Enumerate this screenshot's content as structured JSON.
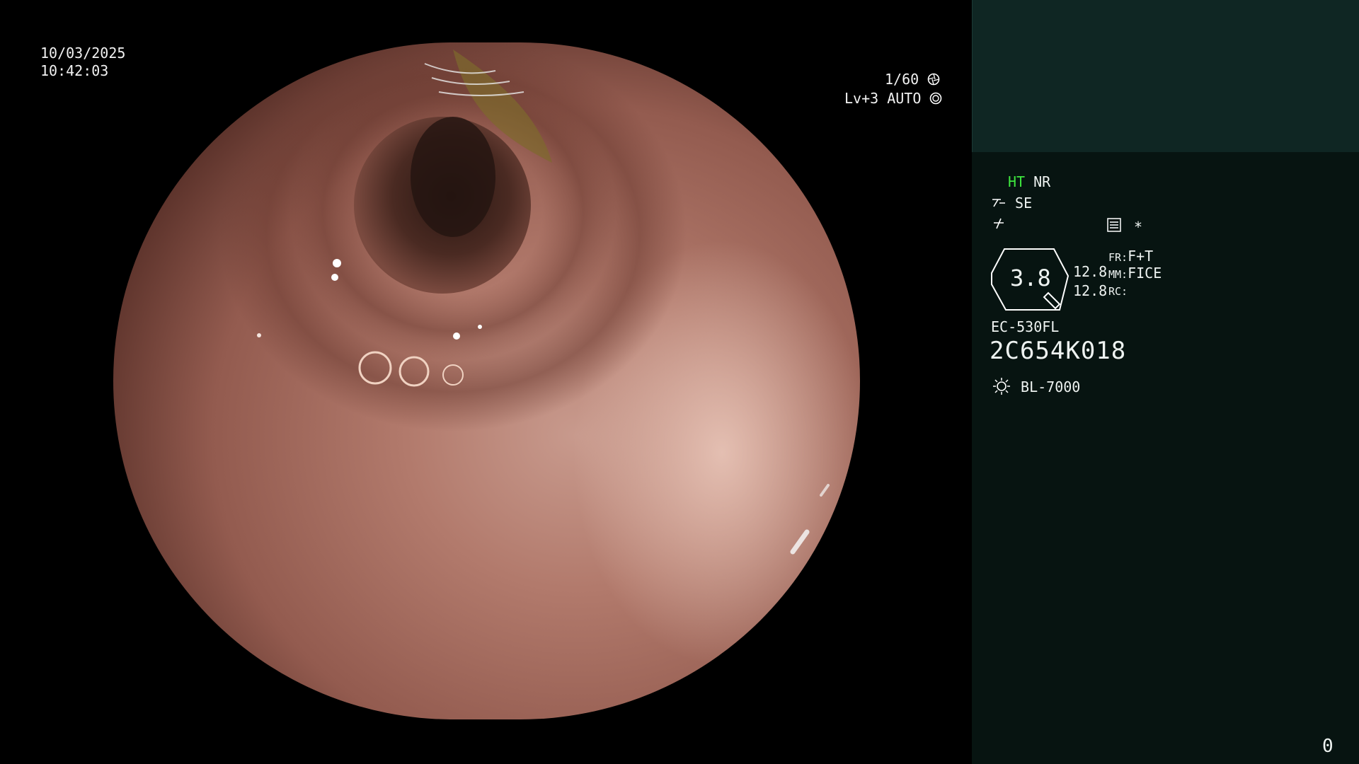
{
  "overlay": {
    "date": "10/03/2025",
    "time": "10:42:03",
    "shutter": "1/60",
    "shutter_icon": "aperture-icon",
    "level_mode": "Lv+3 AUTO",
    "level_icon": "target-icon"
  },
  "panel": {
    "ht_label": "HT",
    "nr_label": "NR",
    "ht_color": "#3ee63e",
    "se_label": "SE",
    "se_icon": "structure-enhance-icon",
    "color_icon": "color-tone-icon",
    "menu_icon": "menu-list-icon",
    "star_label": "*",
    "zoom_value": "3.8",
    "value_top": "12.8",
    "value_bottom": "12.8",
    "fr_label": "FR:",
    "fr_value": "F+T",
    "mm_label": "MM:",
    "mm_value": "FICE",
    "rc_label": "RC:",
    "scope_model": "EC-530FL",
    "scope_serial": "2C654K018",
    "light_icon": "lamp-icon",
    "light_source": "BL-7000",
    "counter": "0"
  },
  "colors": {
    "panel_bg": "#071411",
    "panel_top": "#0f2623",
    "tissue": "#a3665a"
  }
}
